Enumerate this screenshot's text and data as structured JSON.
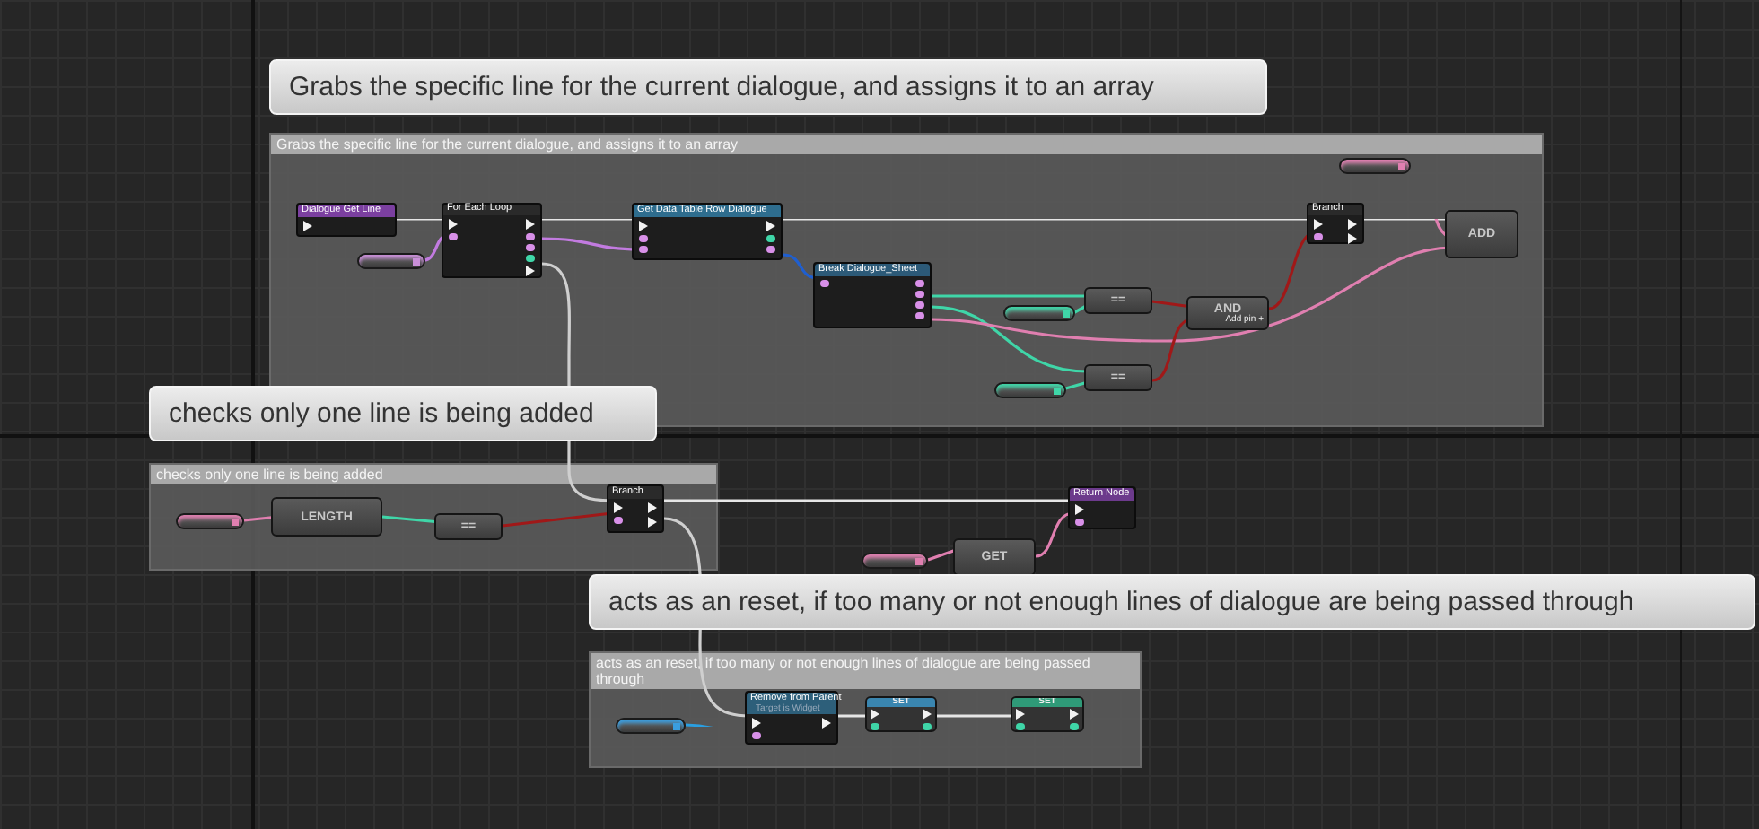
{
  "comments": [
    {
      "bubble": "Grabs the specific line for the current dialogue, and assigns it to an array",
      "header": "Grabs the specific line for the current dialogue, and assigns it to an array"
    },
    {
      "bubble": "checks only one line is being added",
      "header": "checks only one line is being added"
    },
    {
      "bubble": "acts as an reset, if too many or not enough lines of dialogue are being passed through",
      "header": "acts as an reset, if too many or not enough lines of dialogue are being passed through"
    }
  ],
  "nodes": [
    {
      "kind": "event",
      "title": "Dialogue Get Line",
      "color": "#7b3fa0"
    },
    {
      "kind": "macro",
      "title": "For Each Loop"
    },
    {
      "kind": "function",
      "title": "Get Data Table Row Dialogue",
      "color": "#2e6d8e"
    },
    {
      "kind": "function",
      "title": "Break Dialogue_Sheet",
      "color": "#2c5a78"
    },
    {
      "kind": "variable",
      "color": "#c98fd8"
    },
    {
      "kind": "variable",
      "color": "#e07fb0"
    },
    {
      "kind": "pure",
      "title": "=="
    },
    {
      "kind": "variable",
      "color": "#3fd6a8"
    },
    {
      "kind": "pure",
      "title": "=="
    },
    {
      "kind": "variable",
      "color": "#3fd6a8"
    },
    {
      "kind": "pure",
      "title": "AND",
      "subtitle": "Add pin +"
    },
    {
      "kind": "macro",
      "title": "Branch"
    },
    {
      "kind": "pure",
      "title": "ADD"
    },
    {
      "kind": "variable",
      "color": "#e07fb0"
    },
    {
      "kind": "pure",
      "title": "LENGTH"
    },
    {
      "kind": "pure",
      "title": "=="
    },
    {
      "kind": "macro",
      "title": "Branch"
    },
    {
      "kind": "event",
      "title": "Return Node",
      "color": "#6c3a8c"
    },
    {
      "kind": "variable",
      "color": "#e07fb0"
    },
    {
      "kind": "pure",
      "title": "GET"
    },
    {
      "kind": "variable",
      "color": "#3a9ee0"
    },
    {
      "kind": "function",
      "title": "Remove from Parent",
      "subtitle": "Target is Widget",
      "color": "#2d5f7a"
    },
    {
      "kind": "set",
      "title": "SET",
      "color": "#3a86b0"
    },
    {
      "kind": "set",
      "title": "SET",
      "color": "#2f9a78"
    }
  ]
}
